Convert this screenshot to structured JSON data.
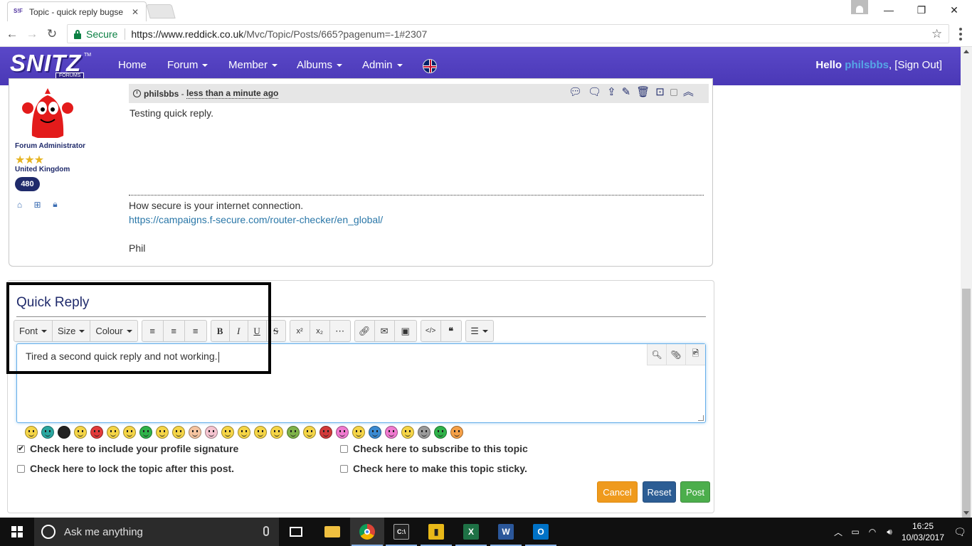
{
  "browser": {
    "tab_title": "Topic - quick reply bugse",
    "tab_favicon": "S!F",
    "secure_label": "Secure",
    "url_scheme_host": "https://www.reddick.co.uk",
    "url_path": "/Mvc/Topic/Posts/665?pagenum=-1#2307"
  },
  "site": {
    "logo_text": "SNITZ",
    "logo_sub": "FORUMS",
    "logo_tm": "TM",
    "nav": {
      "home": "Home",
      "forum": "Forum",
      "member": "Member",
      "albums": "Albums",
      "admin": "Admin"
    },
    "greeting": "Hello",
    "username": "philsbbs",
    "sign_out": ", [Sign Out]"
  },
  "post": {
    "author_rank": "Forum Administrator",
    "stars": "★★★",
    "country": "United Kingdom",
    "post_count": "480",
    "author": "philsbbs",
    "separator": " - ",
    "time": "less than a minute ago",
    "body": "Testing quick reply.",
    "signature_line1": "How secure is your internet connection.",
    "signature_link": "https://campaigns.f-secure.com/router-checker/en_global/",
    "signature_name": "Phil"
  },
  "quick_reply": {
    "title": "Quick Reply",
    "toolbar": {
      "font": "Font",
      "size": "Size",
      "colour": "Colour"
    },
    "editor_value": "Tired a second quick reply and not working.",
    "options": {
      "signature": "Check here to include your profile signature",
      "subscribe": "Check here to subscribe to this topic",
      "lock": "Check here to lock the topic after this post.",
      "sticky": "Check here to make this topic sticky."
    },
    "buttons": {
      "cancel": "Cancel",
      "reset": "Reset",
      "post": "Post"
    }
  },
  "taskbar": {
    "search_placeholder": "Ask me anything",
    "time": "16:25",
    "date": "10/03/2017"
  },
  "colors": {
    "nav_bg": "#4a38b6",
    "accent_link": "#2a77a8",
    "cancel": "#ef9a1d",
    "reset": "#2c5d94",
    "post": "#4cae4c"
  }
}
